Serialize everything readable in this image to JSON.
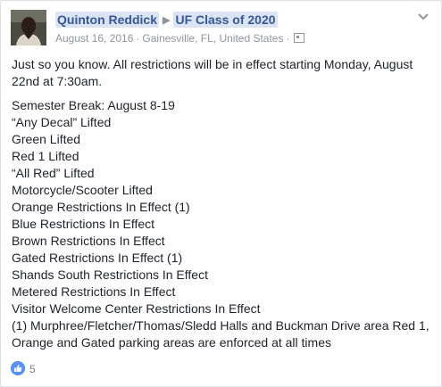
{
  "post": {
    "author": "Quinton Reddick",
    "group": "UF Class of 2020",
    "date": "August 16, 2016",
    "location": "Gainesville, FL, United States",
    "intro": "Just so you know. All restrictions will be in effect starting Monday, August 22nd at 7:30am.",
    "lines": [
      "Semester Break: August 8-19",
      "“Any Decal” Lifted",
      "Green Lifted",
      "Red 1 Lifted",
      "“All Red” Lifted",
      "Motorcycle/Scooter Lifted",
      "Orange Restrictions In Effect (1)",
      "Blue Restrictions In Effect",
      "Brown Restrictions In Effect",
      "Gated Restrictions In Effect (1)",
      "Shands South Restrictions In Effect",
      "Metered Restrictions In Effect",
      "Visitor Welcome Center Restrictions In Effect",
      "(1) Murphree/Fletcher/Thomas/Sledd Halls and Buckman Drive area Red 1, Orange and Gated parking areas are enforced at all times"
    ],
    "likes": "5"
  },
  "icons": {
    "separator": "▶",
    "dot": "·",
    "audience": "group-icon",
    "menu": "chevron-down-icon",
    "like": "like-icon"
  },
  "colors": {
    "link": "#365899",
    "meta": "#90949c",
    "text": "#1d2129",
    "like": "#5890ff"
  }
}
